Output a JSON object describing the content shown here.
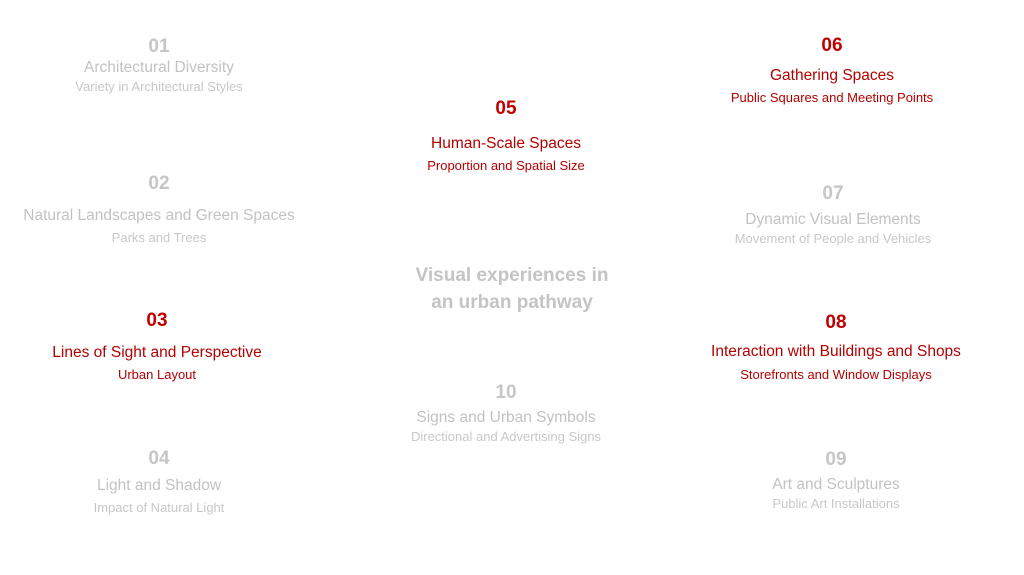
{
  "center": {
    "line1": "Visual experiences in",
    "line2": "an urban pathway"
  },
  "items": [
    {
      "num": "01",
      "title": "Architectural Diversity",
      "sub": "Variety in Architectural Styles",
      "state": "muted"
    },
    {
      "num": "02",
      "title": "Natural Landscapes and Green Spaces",
      "sub": "Parks and Trees",
      "state": "muted"
    },
    {
      "num": "03",
      "title": "Lines of Sight and Perspective",
      "sub": "Urban Layout",
      "state": "active"
    },
    {
      "num": "04",
      "title": "Light and Shadow",
      "sub": "Impact of Natural Light",
      "state": "muted"
    },
    {
      "num": "05",
      "title": "Human-Scale Spaces",
      "sub": "Proportion and Spatial Size",
      "state": "active"
    },
    {
      "num": "06",
      "title": "Gathering Spaces",
      "sub": "Public Squares and Meeting Points",
      "state": "active"
    },
    {
      "num": "07",
      "title": "Dynamic Visual Elements",
      "sub": "Movement of People and Vehicles",
      "state": "muted"
    },
    {
      "num": "08",
      "title": "Interaction with Buildings and Shops",
      "sub": "Storefronts and Window Displays",
      "state": "active"
    },
    {
      "num": "09",
      "title": "Art and Sculptures",
      "sub": "Public Art Installations",
      "state": "muted"
    },
    {
      "num": "10",
      "title": "Signs and Urban Symbols",
      "sub": "Directional and Advertising Signs",
      "state": "muted"
    }
  ],
  "colors": {
    "accent": "#c00000",
    "muted": "#c4c4c4"
  }
}
